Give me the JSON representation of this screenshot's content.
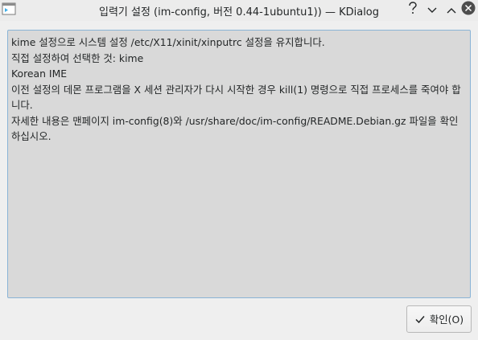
{
  "window": {
    "title": "입력기 설정 (im-config, 버전 0.44-1ubuntu1)) — KDialog",
    "app_icon": "kdialog-app-icon",
    "controls": {
      "help_icon": "help-icon",
      "minimize_icon": "chevron-down-icon",
      "maximize_icon": "chevron-up-icon",
      "close_icon": "close-icon"
    }
  },
  "message": {
    "lines": [
      "kime 설정으로 시스템 설정 /etc/X11/xinit/xinputrc 설정을 유지합니다.",
      "직접 설정하여 선택한 것: kime",
      "Korean IME",
      "이전 설정의 데몬 프로그램을 X 세션 관리자가 다시 시작한 경우 kill(1) 명령으로 직접 프로세스를 죽여야 합니다.",
      "자세한 내용은 맨페이지 im-config(8)와 /usr/share/doc/im-config/README.Debian.gz 파일을 확인하십시오."
    ]
  },
  "buttons": {
    "ok_label": "확인(O)",
    "ok_icon": "checkmark-icon"
  },
  "colors": {
    "window_bg": "#efefef",
    "message_bg": "#d9d9d9",
    "focus_border": "#8ab4d6",
    "close_button": "#4d4d4d"
  }
}
